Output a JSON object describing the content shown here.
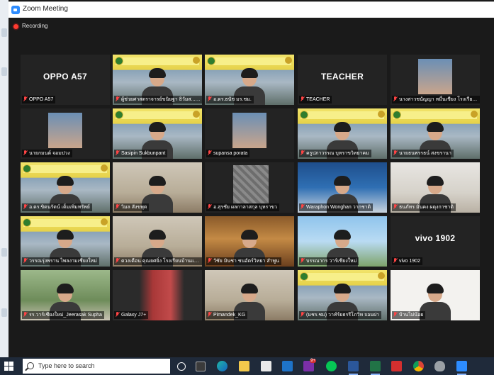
{
  "window": {
    "title": "Zoom Meeting",
    "recording_label": "Recording"
  },
  "tiles": [
    {
      "id": "t1",
      "bigname": "OPPO A57",
      "label": "OPPO A57",
      "bg": "dark"
    },
    {
      "id": "t2",
      "bigname": "",
      "label": "ผู้ช่วยศาสตราจารย์ขนิษฐา ธิวัมส... C...",
      "bg": "yellow"
    },
    {
      "id": "t3",
      "bigname": "",
      "label": "อ.ดร.ธนัช มร.ชม.",
      "bg": "yellow"
    },
    {
      "id": "t4",
      "bigname": "TEACHER",
      "label": "TEACHER",
      "bg": "dark"
    },
    {
      "id": "t5",
      "bigname": "",
      "label": "นางสาวชนัญญา หมื่นเชียง โรงเรียนร...",
      "bg": "thumb"
    },
    {
      "id": "t6",
      "bigname": "",
      "label": "นายกมนต์ จอมปวง",
      "bg": "thumb"
    },
    {
      "id": "t7",
      "bigname": "",
      "label": "Sasipin Sukbunpant",
      "bg": "yellow",
      "active": true
    },
    {
      "id": "t8",
      "bigname": "",
      "label": "supansa porata",
      "bg": "thumb"
    },
    {
      "id": "t9",
      "bigname": "",
      "label": "ครูปภาวรรณ บุหราขวิทยาคม",
      "bg": "yellow"
    },
    {
      "id": "t10",
      "bigname": "",
      "label": "นายธนพรรธน์ สงขรานา",
      "bg": "yellow"
    },
    {
      "id": "t11",
      "bigname": "",
      "label": "อ.ดร.ขิดนรัตน์ เต็มเพิ่มทรัพย์",
      "bg": "yellow"
    },
    {
      "id": "t12",
      "bigname": "",
      "label": "วิมล สังขพุต",
      "bg": "room"
    },
    {
      "id": "t13",
      "bigname": "",
      "label": "อ.สุรชัย ผลกาลาสกุล บุหราขว",
      "bg": "gray"
    },
    {
      "id": "t14",
      "bigname": "",
      "label": "Waraphon Wonghan วากชาติ",
      "bg": "pa"
    },
    {
      "id": "t15",
      "bigname": "",
      "label": "ธนภัทร มั่นคง ผดุงกาชาติ",
      "bg": "room2"
    },
    {
      "id": "t16",
      "bigname": "",
      "label": "วรรณรุ่งพราน ไพลงามเชียงใหม่",
      "bg": "yellow"
    },
    {
      "id": "t17",
      "bigname": "",
      "label": "ดวงเดือน คุณยศยิ่ง โรงเรียนบ้านแม่ม�",
      "bg": "room"
    },
    {
      "id": "t18",
      "bigname": "",
      "label": "วัชัย มินชา ชนอัตร์วิทยา สำพูน",
      "bg": "gold"
    },
    {
      "id": "t19",
      "bigname": "",
      "label": "บรรณากร วาร์เชียงใหม่",
      "bg": "blue"
    },
    {
      "id": "t20",
      "bigname": "vivo 1902",
      "label": "vivo 1902",
      "bg": "dark"
    },
    {
      "id": "t21",
      "bigname": "",
      "label": "รร.วาร์เชียงใหม่_Jeerasak Supha",
      "bg": "park"
    },
    {
      "id": "t22",
      "bigname": "",
      "label": "Galaxy J7+",
      "bg": "red"
    },
    {
      "id": "t23",
      "bigname": "",
      "label": "Pimandek_KG",
      "bg": "room"
    },
    {
      "id": "t24",
      "bigname": "",
      "label": "(มชร.ชม) วาท์ร์ยธรรีโภวิท จอมผ่า",
      "bg": "yellow"
    },
    {
      "id": "t25",
      "bigname": "",
      "label": "บ้านไม่น้อย",
      "bg": "white"
    }
  ],
  "taskbar": {
    "search_placeholder": "Type here to search",
    "icons": [
      "start-icon",
      "task-view-icon",
      "widgets-icon",
      "edge-icon",
      "file-explorer-icon",
      "store-icon",
      "mail-icon",
      "notification-badge-icon",
      "line-icon",
      "word-icon",
      "excel-icon",
      "acrobat-icon",
      "chrome-icon",
      "security-icon",
      "zoom-icon"
    ],
    "badge": "9+"
  },
  "colors": {
    "active_speaker_border": "#9fd43b",
    "muted_mic": "#ff4444",
    "recording_dot": "#ff3b30",
    "zoom_blue": "#2d8cff",
    "taskbar": "#1f2a3a"
  }
}
